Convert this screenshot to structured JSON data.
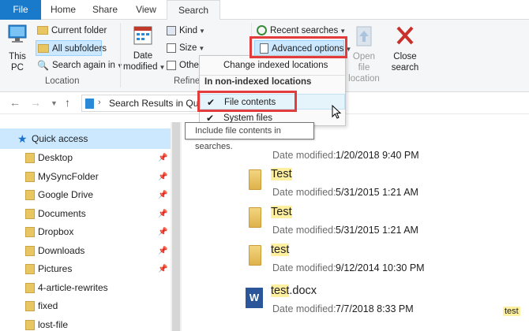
{
  "tabs": {
    "file": "File",
    "home": "Home",
    "share": "Share",
    "view": "View",
    "search": "Search"
  },
  "ribbon": {
    "location": {
      "this_pc": "This PC",
      "current_folder": "Current folder",
      "all_subfolders": "All subfolders",
      "search_again": "Search again in",
      "group_label": "Location"
    },
    "refine": {
      "date_modified_1": "Date",
      "date_modified_2": "modified",
      "kind": "Kind",
      "size": "Size",
      "other": "Othe",
      "group_label": "Refine"
    },
    "options": {
      "recent_searches": "Recent searches",
      "advanced_options": "Advanced options",
      "open_file_location_1": "Open file",
      "open_file_location_2": "location",
      "close_search_1": "Close",
      "close_search_2": "search"
    }
  },
  "address": {
    "path": "Search Results in Quic"
  },
  "dropdown": {
    "change_indexed": "Change indexed locations",
    "header": "In non-indexed locations",
    "file_contents": "File contents",
    "system_files": "System files"
  },
  "tooltip": "Include file contents in searches.",
  "nav": {
    "quick_access": "Quick access",
    "items": [
      {
        "label": "Desktop",
        "pinned": true
      },
      {
        "label": "MySyncFolder",
        "pinned": true
      },
      {
        "label": "Google Drive",
        "pinned": true
      },
      {
        "label": "Documents",
        "pinned": true
      },
      {
        "label": "Dropbox",
        "pinned": true
      },
      {
        "label": "Downloads",
        "pinned": true
      },
      {
        "label": "Pictures",
        "pinned": true
      },
      {
        "label": "4-article-rewrites",
        "pinned": false
      },
      {
        "label": "fixed",
        "pinned": false
      },
      {
        "label": "lost-file",
        "pinned": false
      }
    ]
  },
  "files": {
    "date_label": "Date modified:",
    "rows": [
      {
        "name": "",
        "ext": "",
        "date": "1/20/2018 9:40 PM"
      },
      {
        "name": "Test",
        "ext": "",
        "date": "5/31/2015 1:21 AM"
      },
      {
        "name": "Test",
        "ext": "",
        "date": "5/31/2015 1:21 AM"
      },
      {
        "name": "test",
        "ext": "",
        "date": "9/12/2014 10:30 PM"
      },
      {
        "name": "test",
        "ext": ".docx",
        "date": "7/7/2018 8:33 PM",
        "tag": "test"
      }
    ]
  },
  "colors": {
    "accent": "#1979ca",
    "annotation": "#e23c3c",
    "highlight": "#fff0a0",
    "selection": "#cce8ff"
  }
}
